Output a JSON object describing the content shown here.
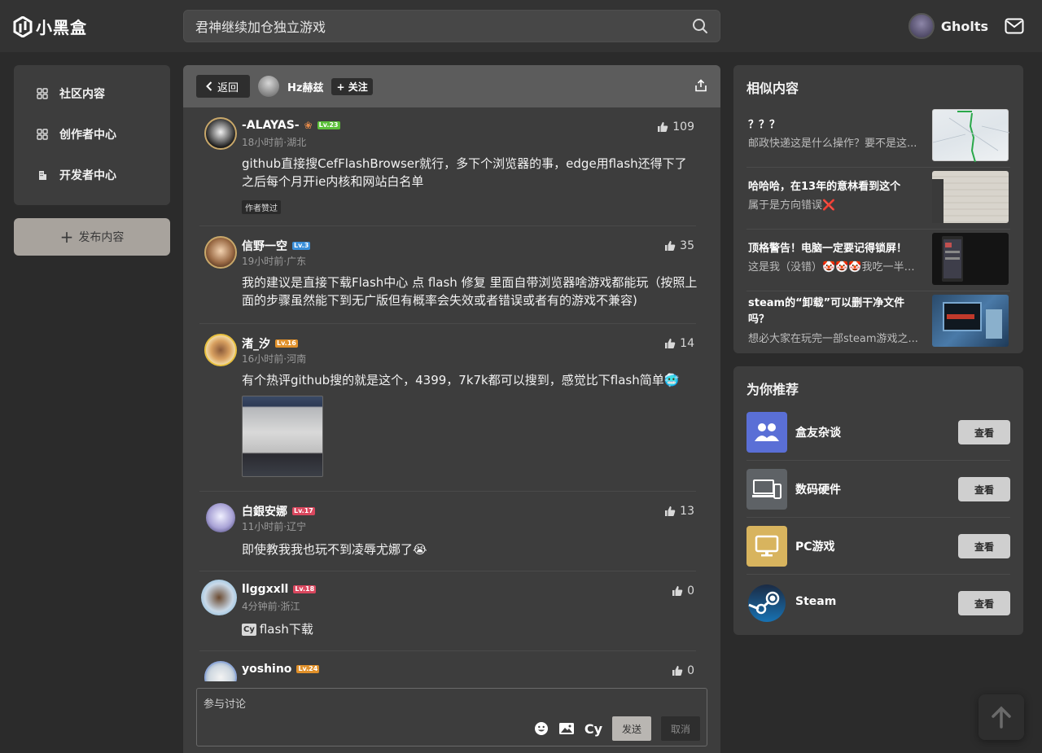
{
  "app": {
    "logo_text": "小黑盒"
  },
  "search": {
    "value": "君神继续加仓独立游戏"
  },
  "user": {
    "name": "Gholts"
  },
  "leftnav": {
    "items": [
      {
        "label": "社区内容",
        "icon": "grid-icon"
      },
      {
        "label": "创作者中心",
        "icon": "grid-icon"
      },
      {
        "label": "开发者中心",
        "icon": "building-icon"
      }
    ],
    "publish_label": "发布内容"
  },
  "main": {
    "back_label": "返回",
    "poster_name": "Hz赫兹",
    "follow_label": "关注",
    "comments": [
      {
        "name": "-ALAYAS-",
        "level": "Lv.23",
        "level_color": "#5bbf3a",
        "time": "18小时前·湖北",
        "likes": "109",
        "text": "github直接搜CefFlashBrowser就行，多下个浏览器的事，edge用flash还得下了之后每个月开ie内核和网站白名单",
        "badge": "作者赞过"
      },
      {
        "name": "信野一空",
        "level": "Lv.3",
        "level_color": "#3a8fd9",
        "time": "19小时前·广东",
        "likes": "35",
        "text": "我的建议是直接下载Flash中心 点 flash 修复 里面自带浏览器啥游戏都能玩（按照上面的步骤虽然能下到无广版但有概率会失效或者错误或者有的游戏不兼容)"
      },
      {
        "name": "渚_汐",
        "level": "Lv.16",
        "level_color": "#e0902a",
        "time": "16小时前·河南",
        "likes": "14",
        "text": "有个热评github搜的就是这个，4399，7k7k都可以搜到，感觉比下flash简单🥶"
      },
      {
        "name": "白銀安娜",
        "level": "Lv.17",
        "level_color": "#d9475e",
        "time": "11小时前·辽宁",
        "likes": "13",
        "text": "即使教我我也玩不到凌辱尤娜了😭"
      },
      {
        "name": "llggxxll",
        "level": "Lv.18",
        "level_color": "#d9475e",
        "time": "4分钟前·浙江",
        "likes": "0",
        "text": "flash下载"
      },
      {
        "name": "yoshino",
        "level": "Lv.24",
        "level_color": "#e0902a",
        "likes": "0"
      }
    ],
    "reply_placeholder": "参与讨论",
    "send_label": "发送",
    "cancel_label": "取消"
  },
  "similar": {
    "title": "相似内容",
    "items": [
      {
        "title": "？？？",
        "desc": "邮政快递这是什么操作？要不是这..."
      },
      {
        "title": "哈哈哈，在13年的意林看到这个",
        "desc": "属于是方向错误❌"
      },
      {
        "title": "顶格警告！电脑一定要记得锁屏！",
        "desc": "这是我（没错）🤡🤡🤡我吃一半下..."
      },
      {
        "title": "steam的“卸载”可以删干净文件吗？",
        "desc": "想必大家在玩完一部steam游戏之..."
      }
    ]
  },
  "recommend": {
    "title": "为你推荐",
    "items": [
      {
        "name": "盒友杂谈",
        "button": "查看",
        "color": "#5a6fd6"
      },
      {
        "name": "数码硬件",
        "button": "查看",
        "color": "#5e6266"
      },
      {
        "name": "PC游戏",
        "button": "查看",
        "color": "#d8b45e"
      },
      {
        "name": "Steam",
        "button": "查看",
        "color": "#1b2838"
      }
    ]
  }
}
